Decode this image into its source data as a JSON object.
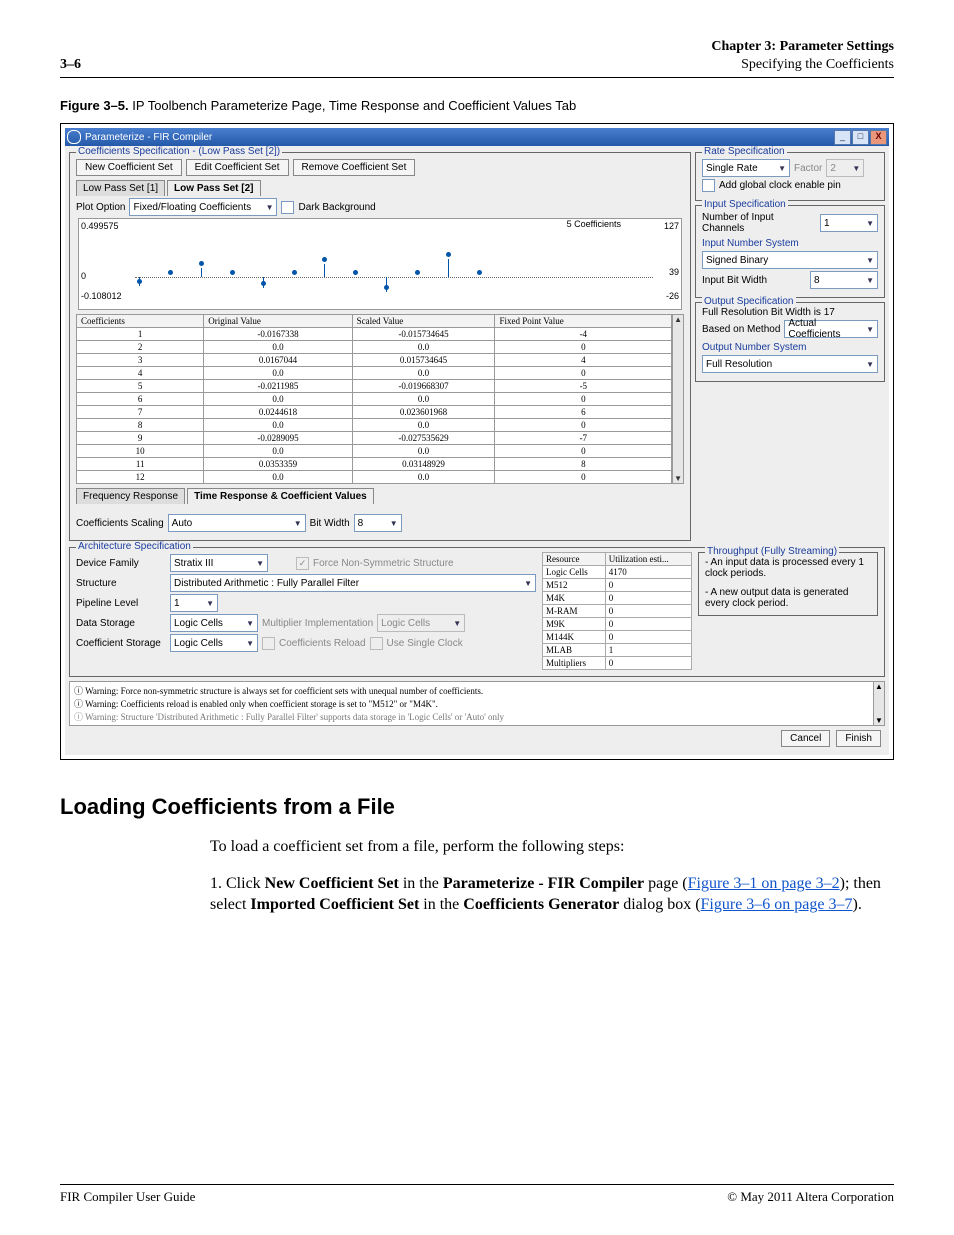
{
  "header": {
    "page_num": "3–6",
    "chapter": "Chapter 3:  Parameter Settings",
    "section": "Specifying the Coefficients"
  },
  "figure": {
    "label": "Figure 3–5.",
    "caption": "IP Toolbench Parameterize Page, Time Response and Coefficient Values Tab"
  },
  "dlg": {
    "title": "Parameterize - FIR Compiler",
    "coef_spec": {
      "title": "Coefficients Specification - (Low Pass Set [2])",
      "btn_new": "New Coefficient Set",
      "btn_edit": "Edit Coefficient Set",
      "btn_remove": "Remove Coefficient Set",
      "tab1": "Low Pass Set [1]",
      "tab2": "Low Pass Set [2]",
      "plot_opt_label": "Plot Option",
      "plot_opt": "Fixed/Floating Coefficients",
      "dark_bg": "Dark Background",
      "chart_title": "5 Coefficients"
    },
    "chart_y": {
      "top": "0.499575",
      "zero": "0",
      "bottom": "-0.108012"
    },
    "chart_r": {
      "top": "127",
      "mid": "39",
      "bottom": "-26"
    },
    "coef_table": {
      "headers": [
        "Coefficients",
        "Original Value",
        "Scaled Value",
        "Fixed Point Value"
      ],
      "rows": [
        [
          "1",
          "-0.0167338",
          "-0.015734645",
          "-4"
        ],
        [
          "2",
          "0.0",
          "0.0",
          "0"
        ],
        [
          "3",
          "0.0167044",
          "0.015734645",
          "4"
        ],
        [
          "4",
          "0.0",
          "0.0",
          "0"
        ],
        [
          "5",
          "-0.0211985",
          "-0.019668307",
          "-5"
        ],
        [
          "6",
          "0.0",
          "0.0",
          "0"
        ],
        [
          "7",
          "0.0244618",
          "0.023601968",
          "6"
        ],
        [
          "8",
          "0.0",
          "0.0",
          "0"
        ],
        [
          "9",
          "-0.0289095",
          "-0.027535629",
          "-7"
        ],
        [
          "10",
          "0.0",
          "0.0",
          "0"
        ],
        [
          "11",
          "0.0353359",
          "0.03148929",
          "8"
        ],
        [
          "12",
          "0.0",
          "0.0",
          "0"
        ]
      ],
      "sub_tab1": "Frequency Response",
      "sub_tab2": "Time Response & Coefficient Values",
      "scaling_label": "Coefficients Scaling",
      "scaling": "Auto",
      "bw_label": "Bit Width",
      "bw": "8"
    },
    "rate": {
      "title": "Rate Specification",
      "value": "Single Rate",
      "factor_label": "Factor",
      "factor": "2",
      "add_clk": "Add global clock enable pin"
    },
    "input": {
      "title": "Input Specification",
      "ch_label": "Number of Input Channels",
      "ch": "1",
      "numsys": "Input Number System",
      "numsys_v": "Signed Binary",
      "ibw_label": "Input Bit Width",
      "ibw": "8"
    },
    "output": {
      "title": "Output Specification",
      "full_res": "Full Resolution Bit Width is 17",
      "method_label": "Based on Method",
      "method": "Actual Coefficients",
      "onumsys": "Output Number System",
      "onumsys_v": "Full Resolution"
    },
    "arch": {
      "title": "Architecture Specification",
      "dev_label": "Device Family",
      "dev": "Stratix III",
      "force": "Force Non-Symmetric Structure",
      "struct_label": "Structure",
      "struct": "Distributed Arithmetic : Fully Parallel Filter",
      "pipe_label": "Pipeline Level",
      "pipe": "1",
      "data_label": "Data Storage",
      "data": "Logic Cells",
      "mult_label": "Multiplier Implementation",
      "mult": "Logic Cells",
      "coefst_label": "Coefficient Storage",
      "coefst": "Logic Cells",
      "reload": "Coefficients Reload",
      "single": "Use Single Clock",
      "res": {
        "hdr": [
          "Resource",
          "Utilization esti..."
        ],
        "rows": [
          [
            "Logic Cells",
            "4170"
          ],
          [
            "M512",
            "0"
          ],
          [
            "M4K",
            "0"
          ],
          [
            "M-RAM",
            "0"
          ],
          [
            "M9K",
            "0"
          ],
          [
            "M144K",
            "0"
          ],
          [
            "MLAB",
            "1"
          ],
          [
            "Multipliers",
            "0"
          ]
        ]
      },
      "thr_title": "Throughput (Fully Streaming)",
      "thr1": "- An input data is processed every 1 clock periods.",
      "thr2": "- A new output data is generated every clock period."
    },
    "warn1": "Warning: Force non-symmetric structure is always set for coefficient sets with unequal number of coefficients.",
    "warn2": "Warning: Coefficients reload is enabled only when coefficient storage is set to \"M512\" or \"M4K\".",
    "warn3": "Warning: Structure 'Distributed Arithmetic : Fully Parallel Filter' supports data storage in 'Logic Cells' or 'Auto' only",
    "cancel": "Cancel",
    "finish": "Finish"
  },
  "section": {
    "heading": "Loading Coefficients from a File",
    "intro": "To load a coefficient set from a file, perform the following steps:",
    "step1_a": "1.   Click ",
    "step1_b": "New Coefficient Set",
    "step1_c": " in the ",
    "step1_d": "Parameterize - FIR Compiler",
    "step1_e": " page (",
    "step1_link1": "Figure 3–1 on page 3–2",
    "step1_f": "); then select ",
    "step1_g": "Imported Coefficient Set",
    "step1_h": " in the ",
    "step1_i": "Coefficients Generator",
    "step1_j": " dialog box (",
    "step1_link2": "Figure 3–6 on page 3–7",
    "step1_k": ")."
  },
  "footer": {
    "left": "FIR Compiler User Guide",
    "right": "© May 2011    Altera Corporation"
  },
  "chart_data": {
    "type": "bar",
    "title": "5 Coefficients",
    "x": [
      1,
      2,
      3,
      4,
      5,
      6,
      7,
      8,
      9,
      10,
      11,
      12
    ],
    "series": [
      {
        "name": "Original",
        "values": [
          -0.0167338,
          0.0,
          0.0167044,
          0.0,
          -0.0211985,
          0.0,
          0.0244618,
          0.0,
          -0.0289095,
          0.0,
          0.0353359,
          0.0
        ]
      },
      {
        "name": "Fixed Point",
        "values": [
          -4,
          0,
          4,
          0,
          -5,
          0,
          6,
          0,
          -7,
          0,
          8,
          0
        ]
      }
    ],
    "ylim_left": [
      -0.108012,
      0.499575
    ],
    "ylim_right": [
      -26,
      127
    ]
  }
}
